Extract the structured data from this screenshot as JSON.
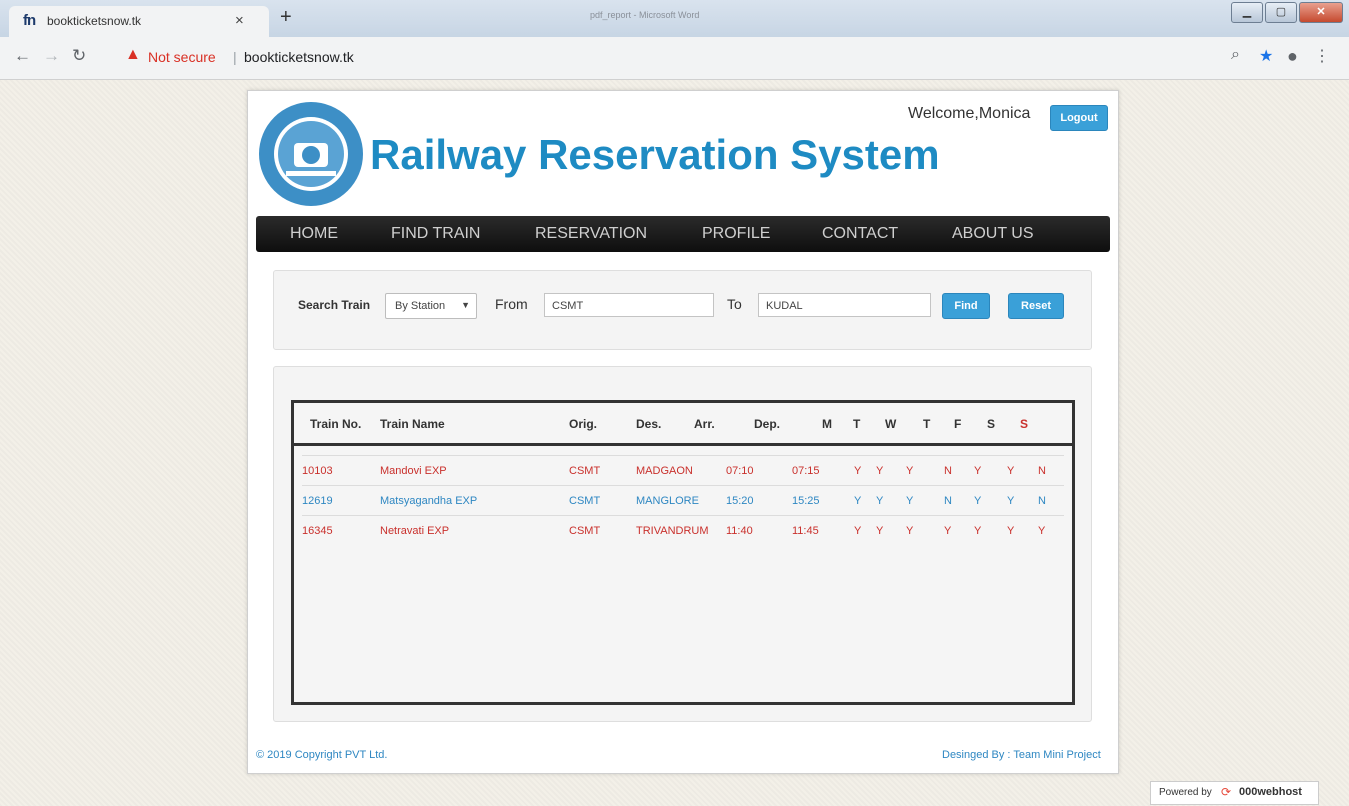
{
  "browser": {
    "tab_title": "bookticketsnow.tk",
    "tab_favicon": "fn",
    "background_window_title": "pdf_report - Microsoft Word",
    "security_label": "Not secure",
    "url": "bookticketsnow.tk"
  },
  "header": {
    "site_title": "Railway Reservation System",
    "welcome_text": "Welcome,Monica",
    "logout_label": "Logout"
  },
  "menu": [
    {
      "label": "HOME"
    },
    {
      "label": "FIND TRAIN"
    },
    {
      "label": "RESERVATION"
    },
    {
      "label": "PROFILE"
    },
    {
      "label": "CONTACT"
    },
    {
      "label": "ABOUT US"
    }
  ],
  "search": {
    "label": "Search Train",
    "mode": "By Station",
    "from_label": "From",
    "from_value": "CSMT",
    "to_label": "To",
    "to_value": "KUDAL",
    "find_label": "Find",
    "reset_label": "Reset"
  },
  "table": {
    "headers": [
      "Train No.",
      "Train Name",
      "Orig.",
      "Des.",
      "Arr.",
      "Dep.",
      "M",
      "T",
      "W",
      "T",
      "F",
      "S",
      "S"
    ],
    "rows": [
      {
        "no": "10103",
        "name": "Mandovi EXP",
        "orig": "CSMT",
        "des": "MADGAON",
        "arr": "07:10",
        "dep": "07:15",
        "days": [
          "Y",
          "Y",
          "Y",
          "N",
          "Y",
          "Y",
          "N"
        ],
        "color": "#c9302c"
      },
      {
        "no": "12619",
        "name": "Matsyagandha EXP",
        "orig": "CSMT",
        "des": "MANGLORE",
        "arr": "15:20",
        "dep": "15:25",
        "days": [
          "Y",
          "Y",
          "Y",
          "N",
          "Y",
          "Y",
          "N"
        ],
        "color": "#2e87c2"
      },
      {
        "no": "16345",
        "name": "Netravati EXP",
        "orig": "CSMT",
        "des": "TRIVANDRUM",
        "arr": "11:40",
        "dep": "11:45",
        "days": [
          "Y",
          "Y",
          "Y",
          "Y",
          "Y",
          "Y",
          "Y"
        ],
        "color": "#c9302c"
      }
    ]
  },
  "footer": {
    "copyright": "© 2019 Copyright PVT Ltd.",
    "designed_by": "Desinged By : Team Mini Project"
  },
  "powered_by": {
    "text": "Powered by",
    "brand": "000webhost"
  },
  "colors": {
    "title_blue": "#1e8bc3",
    "link_blue": "#2e87c2",
    "row_red": "#c9302c",
    "button_blue": "#3aa0d8"
  }
}
